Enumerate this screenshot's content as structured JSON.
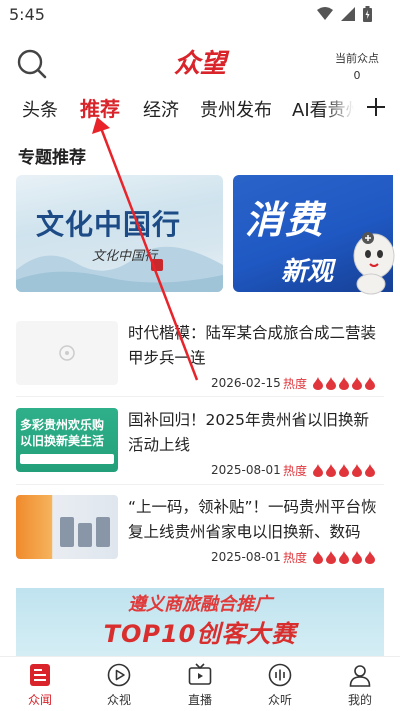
{
  "status_bar": {
    "time": "5:45"
  },
  "header": {
    "logo": "众望",
    "points_label": "当前众点",
    "points_value": "0"
  },
  "tabs": [
    {
      "label": "头条"
    },
    {
      "label": "推荐",
      "active": true
    },
    {
      "label": "经济"
    },
    {
      "label": "贵州发布"
    },
    {
      "label": "AI看贵州"
    }
  ],
  "section": {
    "title": "专题推荐"
  },
  "banners": [
    {
      "big": "文化中国行",
      "small": "文化中国行"
    },
    {
      "big": "消费",
      "sub": "新观"
    }
  ],
  "news": [
    {
      "title": "时代楷模：陆军某合成旅合成二营装甲步兵一连",
      "date": "2026-02-15",
      "heat_label": "热度",
      "flames": 5
    },
    {
      "title": "国补回归！2025年贵州省以旧换新活动上线",
      "date": "2025-08-01",
      "heat_label": "热度",
      "flames": 5,
      "thumb_line1": "多彩贵州欢乐购",
      "thumb_line2": "以旧换新美生活"
    },
    {
      "title": "“上一码，领补贴”！一码贵州平台恢复上线贵州省家电以旧换新、数码",
      "date": "2025-08-01",
      "heat_label": "热度",
      "flames": 5
    }
  ],
  "bottom_banner": {
    "line1": "遵义商旅融合推广",
    "line2": "TOP10创客大赛"
  },
  "bottom_nav": [
    {
      "label": "众闻",
      "icon": "news-icon",
      "active": true
    },
    {
      "label": "众视",
      "icon": "play-icon"
    },
    {
      "label": "直播",
      "icon": "tv-icon"
    },
    {
      "label": "众听",
      "icon": "audio-icon"
    },
    {
      "label": "我的",
      "icon": "person-icon"
    }
  ],
  "colors": {
    "accent": "#d8242a"
  }
}
